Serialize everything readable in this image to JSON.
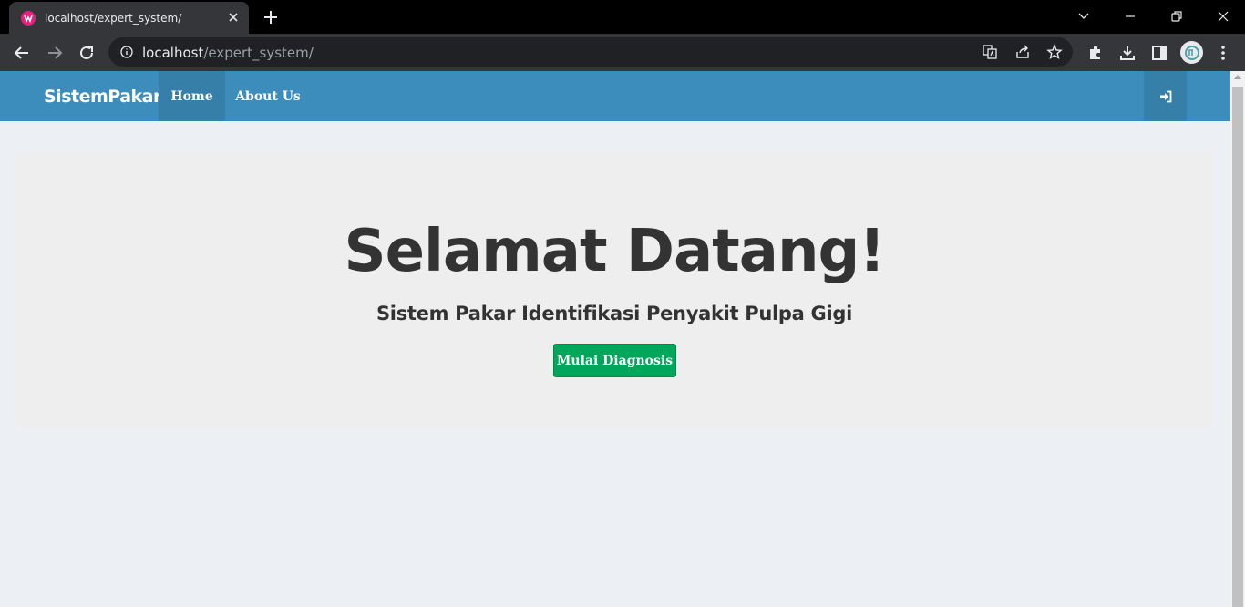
{
  "browser": {
    "tab_title": "localhost/expert_system/",
    "url_host": "localhost",
    "url_path": "/expert_system/"
  },
  "navbar": {
    "brand": "SistemPakar",
    "items": [
      {
        "label": "Home",
        "active": true
      },
      {
        "label": "About Us",
        "active": false
      }
    ],
    "login_icon": "sign-in-icon",
    "color": "#3c8dbc",
    "active_color": "#367fa9"
  },
  "hero": {
    "title": "Selamat Datang!",
    "subtitle": "Sistem Pakar Identifikasi Penyakit Pulpa Gigi",
    "button_label": "Mulai Diagnosis",
    "button_color": "#00a65a"
  }
}
